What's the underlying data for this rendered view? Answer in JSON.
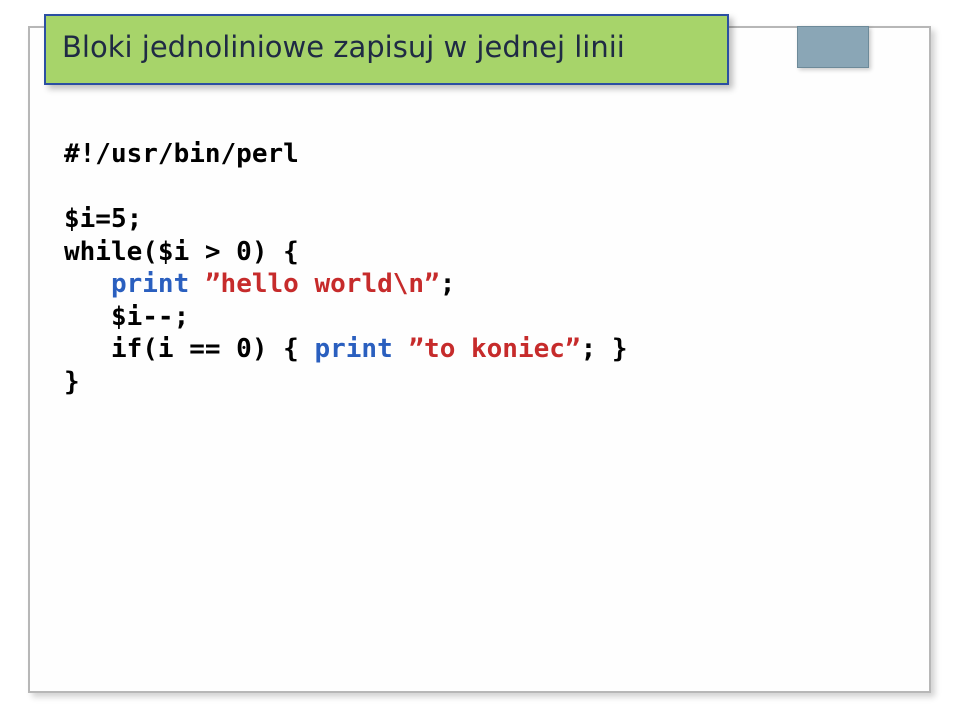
{
  "title": "Bloki jednoliniowe zapisuj w jednej linii",
  "code": {
    "l1": "#!/usr/bin/perl",
    "l2": "$i=5;",
    "l3": "while($i > 0) {",
    "l4_indent": "   ",
    "l4_print": "print",
    "l4_space": " ",
    "l4_str": "”hello world\\n”",
    "l4_semi": ";",
    "l5": "   $i--;",
    "l6_1": "   if(i == 0) { ",
    "l6_print": "print",
    "l6_2": " ",
    "l6_str": "”to koniec”",
    "l6_3": "; }",
    "l7": "}"
  }
}
